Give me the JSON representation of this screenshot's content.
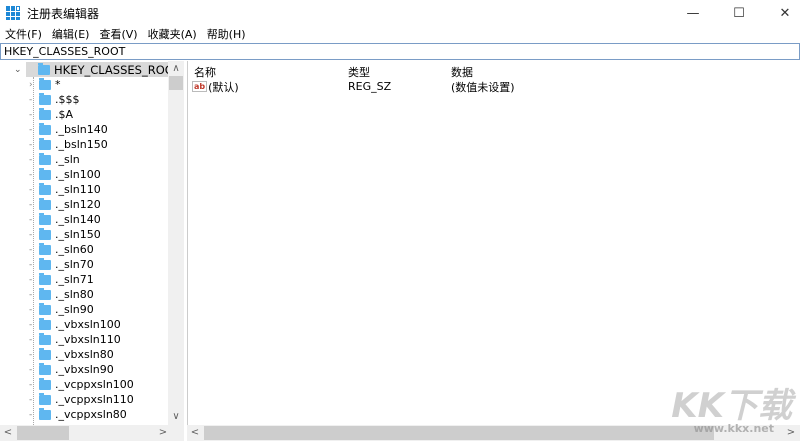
{
  "window": {
    "title": "注册表编辑器",
    "minimize": "—",
    "maximize": "☐",
    "close": "✕"
  },
  "menu": [
    "文件(F)",
    "编辑(E)",
    "查看(V)",
    "收藏夹(A)",
    "帮助(H)"
  ],
  "address": "HKEY_CLASSES_ROOT",
  "tree": {
    "root": "HKEY_CLASSES_ROOT",
    "items": [
      "*",
      ".$$$",
      ".$A",
      "._bsln140",
      "._bsln150",
      "._sln",
      "._sln100",
      "._sln110",
      "._sln120",
      "._sln140",
      "._sln150",
      "._sln60",
      "._sln70",
      "._sln71",
      "._sln80",
      "._sln90",
      "._vbxsln100",
      "._vbxsln110",
      "._vbxsln80",
      "._vbxsln90",
      "._vcppxsln100",
      "._vcppxsln110",
      "._vcppxsln80"
    ]
  },
  "list": {
    "columns": [
      "名称",
      "类型",
      "数据"
    ],
    "rows": [
      {
        "name": "(默认)",
        "type": "REG_SZ",
        "data": "(数值未设置)",
        "icon": "string-value-icon"
      }
    ]
  },
  "watermark": {
    "logo": "KK下载",
    "url": "www.kkx.net"
  }
}
